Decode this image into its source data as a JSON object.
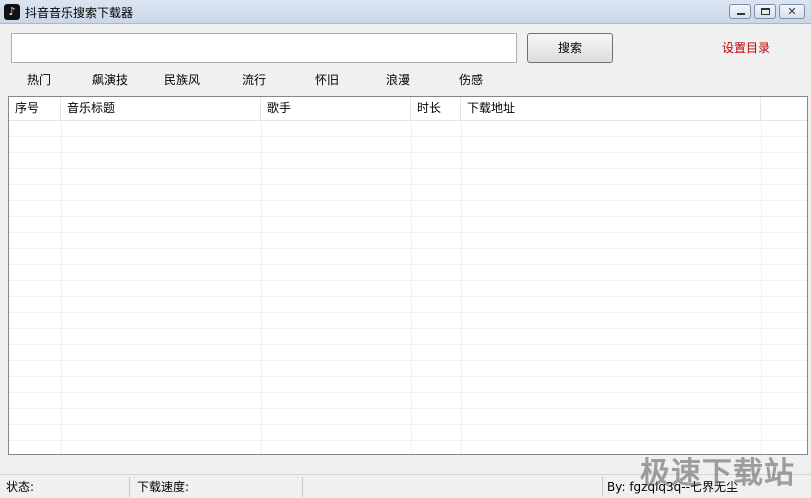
{
  "window": {
    "title": "抖音音乐搜索下载器",
    "app_icon": "music-note-icon",
    "buttons": {
      "minimize": "minimize-icon",
      "maximize": "maximize-icon",
      "close": "close-icon"
    }
  },
  "search": {
    "input_value": "",
    "button_label": "搜索",
    "settings_link": "设置目录"
  },
  "categories": [
    {
      "label": "热门"
    },
    {
      "label": "飙演技"
    },
    {
      "label": "民族风"
    },
    {
      "label": "流行"
    },
    {
      "label": "怀旧"
    },
    {
      "label": "浪漫"
    },
    {
      "label": "伤感"
    }
  ],
  "table": {
    "columns": [
      "序号",
      "音乐标题",
      "歌手",
      "时长",
      "下载地址"
    ],
    "rows": []
  },
  "status": {
    "state_label": "状态:",
    "speed_label": "下载速度:",
    "credit": "By: fgzqlq3q--七界无尘"
  },
  "watermark": "极速下载站",
  "colors": {
    "accent_link": "#c00000"
  }
}
